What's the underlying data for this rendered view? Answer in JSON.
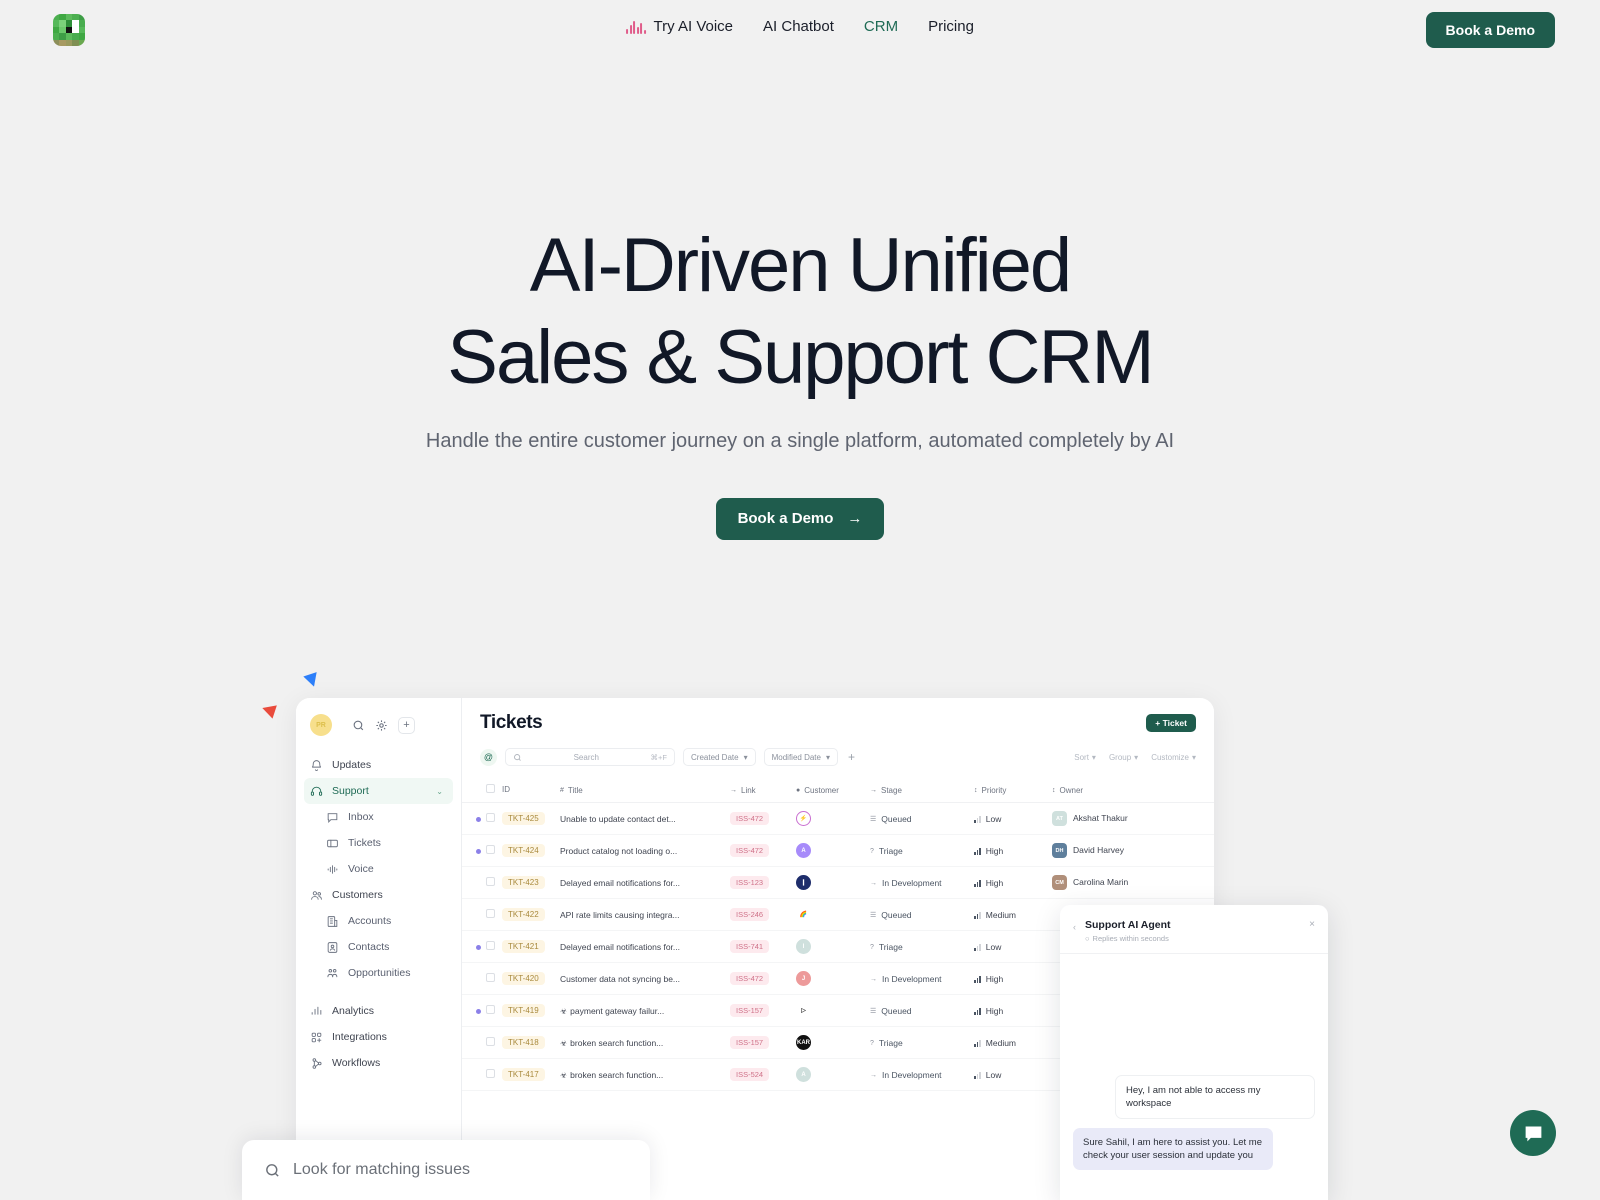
{
  "nav": {
    "logo_name": "pixel-logo",
    "links": [
      {
        "label": "Try AI Voice",
        "active": false,
        "icon": "waveform-icon"
      },
      {
        "label": "AI Chatbot",
        "active": false
      },
      {
        "label": "CRM",
        "active": true
      },
      {
        "label": "Pricing",
        "active": false
      }
    ],
    "cta": "Book a Demo"
  },
  "hero": {
    "title_line1": "AI-Driven Unified",
    "title_line2": "Sales & Support CRM",
    "subtitle": "Handle the entire customer journey on a single platform, automated completely by AI",
    "cta": "Book a Demo",
    "cta_arrow": "→"
  },
  "app": {
    "avatar_initials": "PR",
    "sidebar": [
      {
        "label": "Updates",
        "icon": "bell-icon",
        "level": "top",
        "active": false
      },
      {
        "label": "Support",
        "icon": "headset-icon",
        "level": "top",
        "active": true,
        "chevron": "⌄"
      },
      {
        "label": "Inbox",
        "icon": "chat-icon",
        "level": "sub",
        "active": false
      },
      {
        "label": "Tickets",
        "icon": "ticket-icon",
        "level": "sub",
        "active": false
      },
      {
        "label": "Voice",
        "icon": "waveform-icon",
        "level": "sub",
        "active": false
      },
      {
        "label": "Customers",
        "icon": "users-icon",
        "level": "top",
        "active": false
      },
      {
        "label": "Accounts",
        "icon": "building-icon",
        "level": "sub",
        "active": false
      },
      {
        "label": "Contacts",
        "icon": "contact-card-icon",
        "level": "sub",
        "active": false
      },
      {
        "label": "Opportunities",
        "icon": "opportunity-icon",
        "level": "sub",
        "active": false
      },
      {
        "label": "Analytics",
        "icon": "bar-chart-icon",
        "level": "top",
        "active": false,
        "gap": true
      },
      {
        "label": "Integrations",
        "icon": "grid-plus-icon",
        "level": "top",
        "active": false
      },
      {
        "label": "Workflows",
        "icon": "workflow-icon",
        "level": "top",
        "active": false
      }
    ],
    "page_title": "Tickets",
    "new_ticket_button": "+ Ticket",
    "toolbar": {
      "at": "@",
      "search_placeholder": "Search",
      "search_shortcut": "⌘+F",
      "filters": [
        "Created Date",
        "Modified Date"
      ],
      "add": "+",
      "right": [
        "Sort",
        "Group",
        "Customize"
      ]
    },
    "columns": [
      "ID",
      "Title",
      "Link",
      "Customer",
      "Stage",
      "Priority",
      "Owner"
    ],
    "rows": [
      {
        "dot": true,
        "id": "TKT-425",
        "title": "Unable to update contact det...",
        "bug": false,
        "link": "ISS-472",
        "cust_color": "#ffffff",
        "cust_border": "#c96fd0",
        "cust_text": "⚡",
        "stage": "Queued",
        "stage_icon": "queued-icon",
        "priority": "Low",
        "bars": 1,
        "owner": "Akshat Thakur",
        "owner_color": "#cfe0dd",
        "owner_initials": "AT"
      },
      {
        "dot": true,
        "id": "TKT-424",
        "title": "Product catalog not loading o...",
        "bug": false,
        "link": "ISS-472",
        "cust_color": "#a78bfa",
        "cust_text": "A",
        "stage": "Triage",
        "stage_icon": "question-icon",
        "priority": "High",
        "bars": 3,
        "owner": "David Harvey",
        "owner_color": "#5f7f9c",
        "owner_initials": "DH"
      },
      {
        "dot": false,
        "id": "TKT-423",
        "title": "Delayed email notifications for...",
        "bug": false,
        "link": "ISS-123",
        "cust_color": "#1e2d6b",
        "cust_text": "❙",
        "stage": "In Development",
        "stage_icon": "arrow-icon",
        "priority": "High",
        "bars": 3,
        "owner": "Carolina Marin",
        "owner_color": "#b08f7a",
        "owner_initials": "CM"
      },
      {
        "dot": false,
        "id": "TKT-422",
        "title": "API rate limits causing integra...",
        "bug": false,
        "link": "ISS-246",
        "cust_color": "#ffffff",
        "cust_text": "🌈",
        "stage": "Queued",
        "stage_icon": "queued-icon",
        "priority": "Medium",
        "bars": 2,
        "owner": "",
        "owner_color": "",
        "owner_initials": ""
      },
      {
        "dot": true,
        "id": "TKT-421",
        "title": "Delayed email notifications for...",
        "bug": false,
        "link": "ISS-741",
        "cust_color": "#cfe0dd",
        "cust_text": "I",
        "stage": "Triage",
        "stage_icon": "question-icon",
        "priority": "Low",
        "bars": 1,
        "owner": "",
        "owner_color": "",
        "owner_initials": ""
      },
      {
        "dot": false,
        "id": "TKT-420",
        "title": "Customer data not syncing be...",
        "bug": false,
        "link": "ISS-472",
        "cust_color": "#ed9a9a",
        "cust_text": "J",
        "stage": "In Development",
        "stage_icon": "arrow-icon",
        "priority": "High",
        "bars": 3,
        "owner": "",
        "owner_color": "",
        "owner_initials": ""
      },
      {
        "dot": true,
        "id": "TKT-419",
        "title": "payment gateway failur...",
        "bug": true,
        "link": "ISS-157",
        "cust_color": "#ffffff",
        "cust_text": "▷",
        "stage": "Queued",
        "stage_icon": "queued-icon",
        "priority": "High",
        "bars": 3,
        "owner": "",
        "owner_color": "",
        "owner_initials": ""
      },
      {
        "dot": false,
        "id": "TKT-418",
        "title": "broken search function...",
        "bug": true,
        "link": "ISS-157",
        "cust_color": "#111111",
        "cust_text": "KAR",
        "stage": "Triage",
        "stage_icon": "question-icon",
        "priority": "Medium",
        "bars": 2,
        "owner": "",
        "owner_color": "",
        "owner_initials": ""
      },
      {
        "dot": false,
        "id": "TKT-417",
        "title": "broken search function...",
        "bug": true,
        "link": "ISS-524",
        "cust_color": "#cfe0dd",
        "cust_text": "A",
        "stage": "In Development",
        "stage_icon": "arrow-icon",
        "priority": "Low",
        "bars": 1,
        "owner": "",
        "owner_color": "",
        "owner_initials": ""
      }
    ]
  },
  "chat": {
    "title": "Support AI Agent",
    "status": "Replies within seconds",
    "back": "‹",
    "close": "×",
    "messages": [
      {
        "from": "user",
        "text": "Hey, I am not able to access my workspace"
      },
      {
        "from": "bot",
        "text": "Sure Sahil, I am here to assist you. Let me check your user session and update you"
      }
    ]
  },
  "float_search": {
    "placeholder": "Look for matching issues",
    "icon": "search-icon"
  },
  "fab": {
    "icon": "chat-bubble-icon",
    "color": "#1f6b55"
  },
  "colors": {
    "brand_green": "#1f5c4d",
    "accent_green": "#1f6b55",
    "page_bg": "#f1f1f1"
  }
}
